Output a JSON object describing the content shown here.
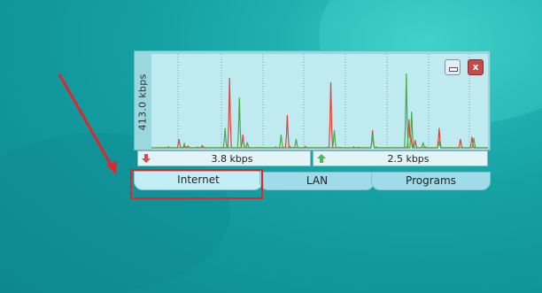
{
  "desktop": {
    "background_color": "#14a0a2"
  },
  "widget": {
    "y_axis_label": "413.0 kbps",
    "minimize_icon": "minimize-icon",
    "close_icon": "close-icon",
    "close_glyph": "x",
    "download": {
      "icon": "download-arrow-icon",
      "color": "#d0504a",
      "value": "3.8 kbps"
    },
    "upload": {
      "icon": "upload-arrow-icon",
      "color": "#59b35a",
      "value": "2.5 kbps"
    },
    "tabs": [
      {
        "label": "Internet",
        "active": true
      },
      {
        "label": "LAN",
        "active": false
      },
      {
        "label": "Programs",
        "active": false
      }
    ]
  },
  "annotation": {
    "color": "#e0262a"
  },
  "chart_data": {
    "type": "line",
    "ylabel": "413.0 kbps",
    "ylim": [
      0,
      413
    ],
    "grid": true,
    "series": [
      {
        "color": "#e0443a",
        "values": [
          0,
          0,
          0,
          0,
          0,
          0,
          0,
          0,
          0,
          0,
          0,
          0,
          0,
          0,
          0,
          0,
          2,
          0,
          0,
          5,
          0,
          0,
          0,
          0,
          0,
          0,
          0,
          0,
          0,
          0,
          0,
          0,
          2,
          0,
          0,
          0,
          0,
          4,
          0,
          0,
          4,
          8,
          4,
          2,
          0,
          0,
          0,
          0,
          0,
          0,
          0,
          2,
          3,
          0,
          2,
          0,
          0,
          10,
          2,
          4,
          0,
          0,
          0,
          0,
          0,
          0,
          0,
          0,
          0,
          0,
          0,
          0,
          0,
          0,
          0,
          0,
          0,
          0,
          0,
          0,
          0,
          0,
          0,
          0,
          0,
          0,
          0,
          0,
          0,
          0,
          0,
          0,
          0,
          0,
          0,
          0,
          0,
          0,
          0,
          0,
          0,
          0,
          0,
          2,
          4,
          0,
          0,
          0,
          1,
          0,
          0,
          0,
          0,
          0,
          0,
          0,
          0,
          0,
          0,
          3,
          0,
          0,
          1,
          0,
          0,
          0,
          0,
          0,
          0,
          0,
          0,
          0,
          0,
          0,
          0,
          0,
          0,
          0,
          0,
          0,
          4,
          0,
          0,
          0,
          0,
          0,
          0,
          0,
          0,
          0,
          2,
          0,
          0,
          0,
          0,
          0,
          5,
          0,
          2,
          0,
          0,
          0,
          0,
          0,
          2,
          0,
          0,
          0,
          0,
          0,
          0,
          0,
          0,
          6,
          0,
          3,
          0,
          0,
          0,
          0,
          0,
          0,
          0,
          0,
          0,
          0,
          0,
          0,
          0,
          0,
          0,
          0,
          0,
          0,
          0,
          0,
          0,
          0,
          3,
          0,
          2,
          0,
          0,
          0,
          0,
          0,
          0,
          0,
          0,
          0,
          0,
          3,
          0,
          2,
          0,
          0,
          0,
          0,
          0,
          0,
          0,
          0,
          0,
          0,
          0,
          0,
          0,
          0,
          5,
          0,
          0,
          0,
          0,
          3,
          2,
          0,
          0,
          0,
          0,
          0,
          0,
          0,
          0,
          0,
          0,
          0,
          0,
          0,
          0,
          0,
          0,
          0,
          0,
          4,
          0,
          0,
          1,
          0,
          0,
          0,
          0,
          0,
          0,
          0,
          0,
          0,
          0,
          0,
          0,
          0,
          0,
          0,
          0,
          0,
          0,
          0,
          0,
          0,
          0,
          0,
          0,
          1,
          0,
          0,
          0,
          2,
          0,
          0,
          0,
          0,
          0,
          0,
          0,
          0,
          0,
          0,
          0,
          0,
          0,
          0,
          0,
          0,
          0,
          0,
          0,
          3,
          0,
          0,
          0,
          4,
          0,
          0,
          0,
          0,
          0,
          0,
          0,
          0,
          0,
          0,
          0,
          0,
          0,
          0,
          0,
          0,
          0,
          0,
          0,
          0,
          0,
          0,
          0,
          0,
          0,
          0,
          0,
          0,
          0,
          2,
          0,
          0,
          0,
          0,
          0,
          0,
          0,
          0,
          0,
          0,
          0,
          0,
          0,
          0,
          0,
          0,
          0,
          0,
          0,
          0,
          0,
          0,
          0,
          0,
          0,
          0,
          0,
          0,
          0,
          0,
          0,
          0,
          0,
          0,
          0,
          0,
          0,
          0,
          0,
          0,
          0,
          0,
          0,
          0,
          0,
          0,
          0,
          0,
          0,
          0,
          0,
          0,
          0,
          0,
          0
        ],
        "peaks": [
          [
            31,
            40
          ],
          [
            88,
            320
          ],
          [
            103,
            60
          ],
          [
            153,
            150
          ],
          [
            202,
            300
          ],
          [
            249,
            80
          ],
          [
            290,
            130
          ],
          [
            292,
            60
          ],
          [
            297,
            35
          ],
          [
            324,
            90
          ],
          [
            348,
            40
          ],
          [
            361,
            50
          ]
        ]
      },
      {
        "color": "#45ad4a",
        "values": [],
        "peaks": [
          [
            37,
            20
          ],
          [
            83,
            90
          ],
          [
            99,
            230
          ],
          [
            108,
            25
          ],
          [
            146,
            60
          ],
          [
            163,
            40
          ],
          [
            206,
            80
          ],
          [
            249,
            60
          ],
          [
            287,
            340
          ],
          [
            293,
            165
          ],
          [
            306,
            25
          ],
          [
            324,
            30
          ],
          [
            363,
            45
          ]
        ]
      }
    ]
  }
}
